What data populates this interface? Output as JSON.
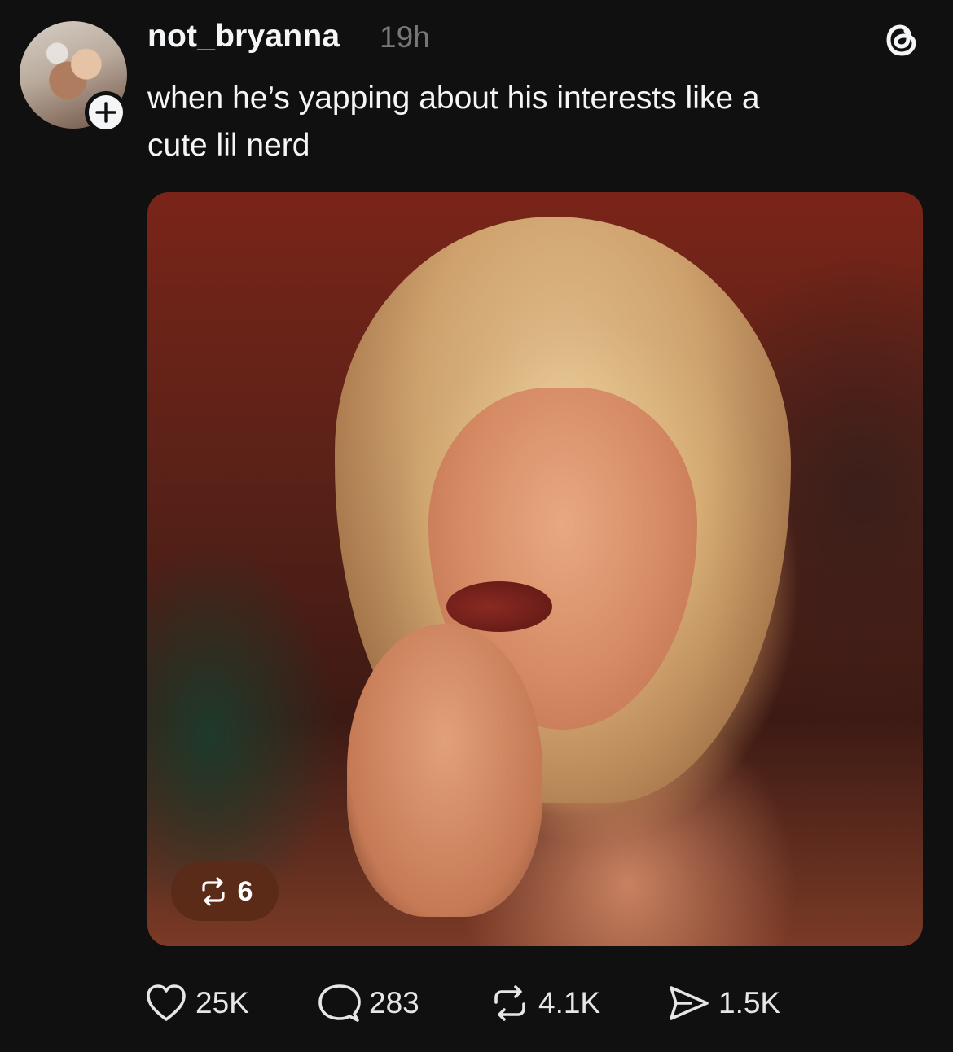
{
  "post": {
    "username": "not_bryanna",
    "timestamp": "19h",
    "caption_line1": "when he’s yapping about his interests like a",
    "caption_line2": "cute lil nerd",
    "media_repost_count": "6"
  },
  "actions": {
    "likes": "25K",
    "replies": "283",
    "reposts": "4.1K",
    "shares": "1.5K"
  },
  "icons": {
    "app": "threads-icon",
    "follow": "plus-icon",
    "like": "heart-icon",
    "reply": "comment-icon",
    "repost": "repost-icon",
    "share": "send-icon"
  },
  "colors": {
    "background": "#101010",
    "text_primary": "#f3f5f7",
    "text_secondary": "#777777",
    "badge_bg": "#5a2a18"
  }
}
